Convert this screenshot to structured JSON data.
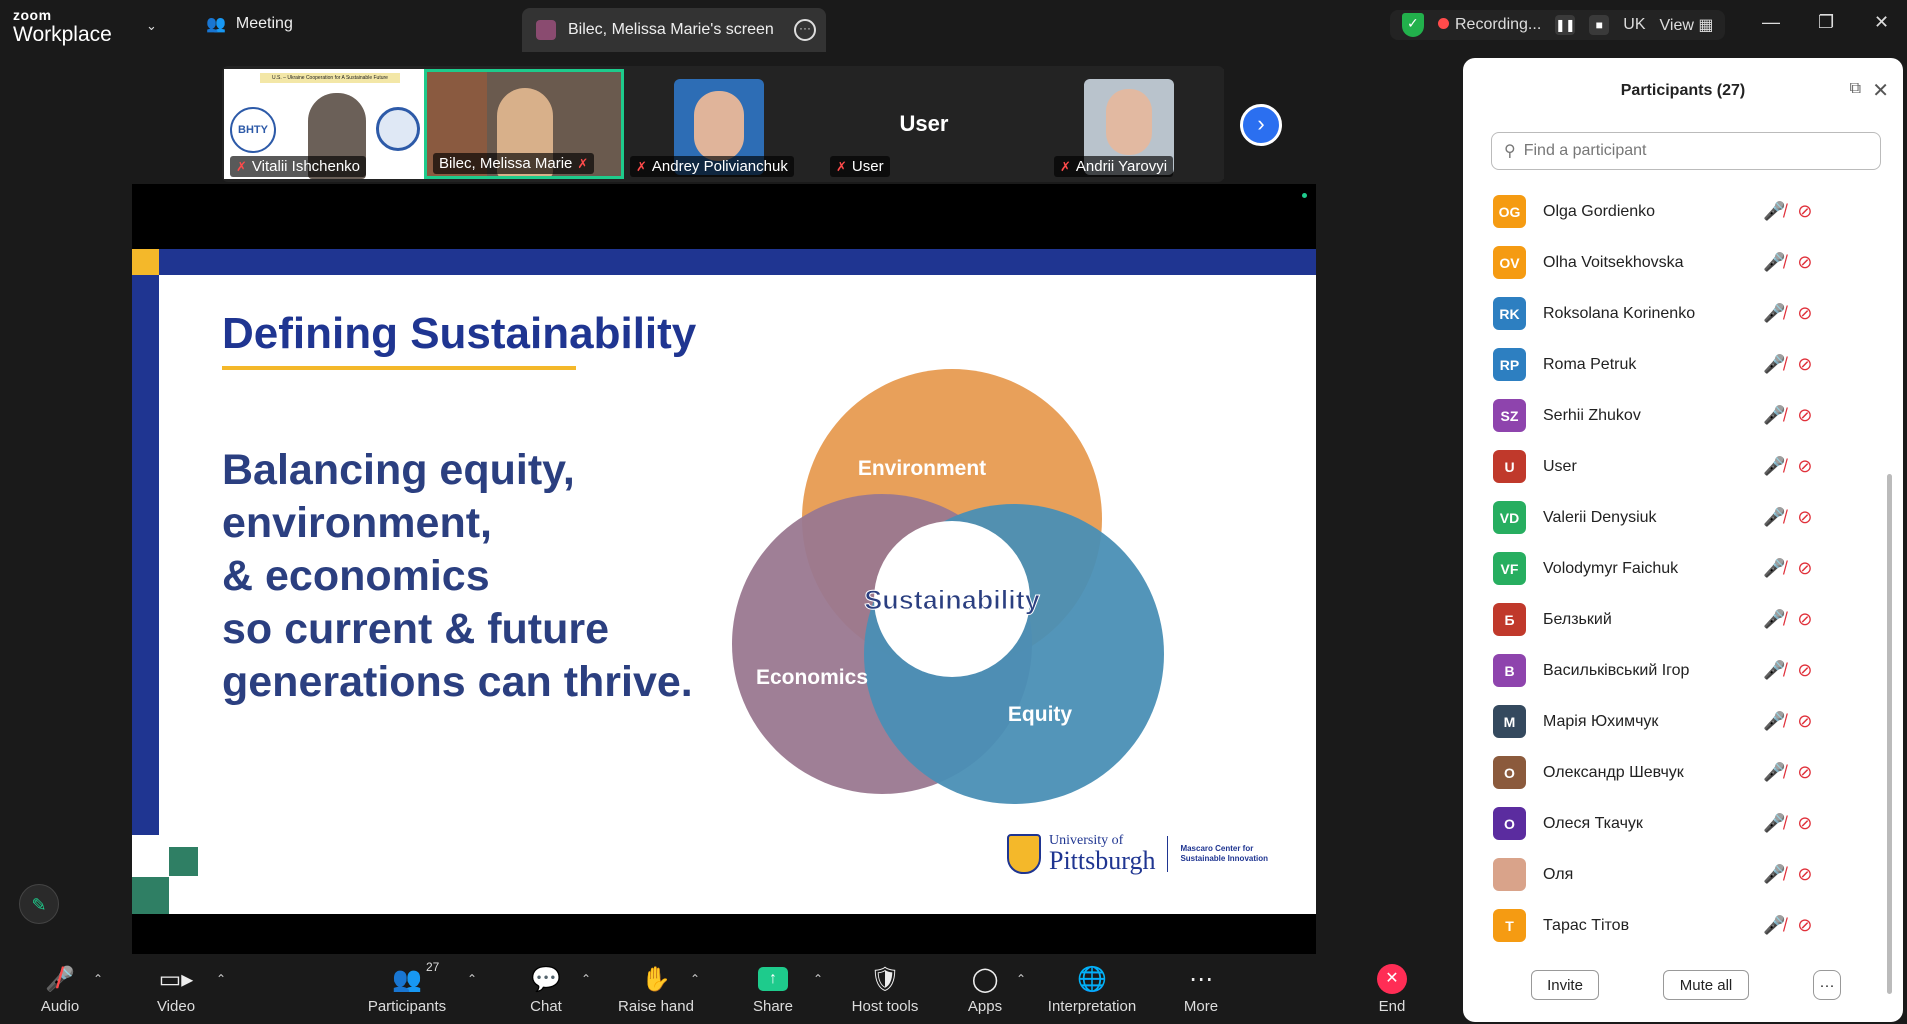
{
  "app": {
    "logo_top": "zoom",
    "logo_bottom": "Workplace"
  },
  "tabs": {
    "meeting": "Meeting",
    "screen": "Bilec, Melissa Marie's screen"
  },
  "status": {
    "recording": "Recording...",
    "language": "UK",
    "view": "View"
  },
  "gallery": {
    "tiles": [
      {
        "name": "Vitalii Ishchenko"
      },
      {
        "name": "Bilec, Melissa Marie"
      },
      {
        "name": "Andrey Polivianchuk"
      },
      {
        "name": "User",
        "placeholder": "User"
      },
      {
        "name": "Andrii Yarovyi"
      }
    ],
    "banner": "U.S. – Ukraine Cooperation for A Sustainable Future",
    "bhtu": "BHTY"
  },
  "slide": {
    "title": "Defining Sustainability",
    "body": [
      "Balancing equity,",
      "environment,",
      "& economics",
      "so current & future",
      "generations can thrive."
    ],
    "venn": {
      "top": "Environment",
      "left": "Economics",
      "right": "Equity",
      "center": "Sustainability"
    },
    "logo": {
      "univ": "University of",
      "pitt": "Pittsburgh",
      "center_line1": "Mascaro Center for",
      "center_line2": "Sustainable Innovation"
    },
    "colors": {
      "navy": "#1f3591",
      "gold": "#f4b82a",
      "teal": "#2f7f64",
      "orange": "#e8a05a",
      "purple": "#9a7890",
      "blue": "#4a8fb5"
    }
  },
  "toolbar": {
    "audio": "Audio",
    "video": "Video",
    "participants": "Participants",
    "participants_count": "27",
    "chat": "Chat",
    "raise_hand": "Raise hand",
    "share": "Share",
    "host_tools": "Host tools",
    "apps": "Apps",
    "interpretation": "Interpretation",
    "more": "More",
    "end": "End"
  },
  "panel": {
    "title": "Participants (27)",
    "search_placeholder": "Find a participant",
    "invite": "Invite",
    "mute_all": "Mute all",
    "more": "···",
    "participants": [
      {
        "initials": "OG",
        "name": "Olga Gordienko",
        "color": "#f59b12"
      },
      {
        "initials": "OV",
        "name": "Olha Voitsekhovska",
        "color": "#f59b12"
      },
      {
        "initials": "RK",
        "name": "Roksolana Korinenko",
        "color": "#2d7fc1"
      },
      {
        "initials": "RP",
        "name": "Roma Petruk",
        "color": "#2d7fc1"
      },
      {
        "initials": "SZ",
        "name": "Serhii Zhukov",
        "color": "#8e44ad"
      },
      {
        "initials": "U",
        "name": "User",
        "color": "#c0392b"
      },
      {
        "initials": "VD",
        "name": "Valerii Denysiuk",
        "color": "#27ae60"
      },
      {
        "initials": "VF",
        "name": "Volodymyr Faichuk",
        "color": "#27ae60"
      },
      {
        "initials": "Б",
        "name": "Белзький",
        "color": "#c0392b"
      },
      {
        "initials": "В",
        "name": "Васильківський Ігор",
        "color": "#8e44ad"
      },
      {
        "initials": "М",
        "name": "Марія Юхимчук",
        "color": "#34495e"
      },
      {
        "initials": "О",
        "name": "Олександр Шевчук",
        "color": "#8b5a3c"
      },
      {
        "initials": "О",
        "name": "Олеся Ткачук",
        "color": "#5b2c9f"
      },
      {
        "initials": "",
        "name": "Оля",
        "color": "#d9a38a"
      },
      {
        "initials": "Т",
        "name": "Тарас Тітов",
        "color": "#f59b12"
      }
    ]
  }
}
